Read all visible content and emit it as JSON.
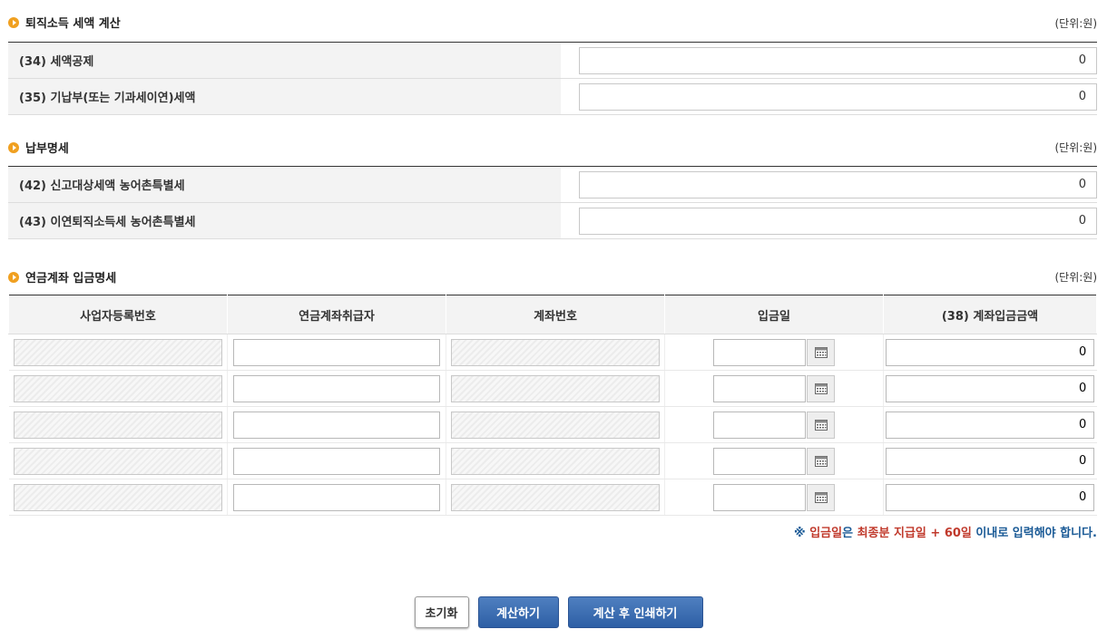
{
  "unit_label": "(단위:원)",
  "section1": {
    "title": "퇴직소득 세액 계산",
    "rows": [
      {
        "label": "(34) 세액공제",
        "value": "0"
      },
      {
        "label": "(35) 기납부(또는 기과세이연)세액",
        "value": "0"
      }
    ]
  },
  "section2": {
    "title": "납부명세",
    "rows": [
      {
        "label": "(42) 신고대상세액 농어촌특별세",
        "value": "0"
      },
      {
        "label": "(43) 이연퇴직소득세 농어촌특별세",
        "value": "0"
      }
    ]
  },
  "section3": {
    "title": "연금계좌 입금명세",
    "columns": [
      "사업자등록번호",
      "연금계좌취급자",
      "계좌번호",
      "입금일",
      "(38) 계좌입금금액"
    ],
    "rows": [
      {
        "amount": "0"
      },
      {
        "amount": "0"
      },
      {
        "amount": "0"
      },
      {
        "amount": "0"
      },
      {
        "amount": "0"
      }
    ]
  },
  "note": [
    {
      "text": "※ ",
      "color": "#1a5a96"
    },
    {
      "text": "입금일",
      "color": "#c0392b"
    },
    {
      "text": "은 ",
      "color": "#1a5a96"
    },
    {
      "text": "최종분 지급일 + 60일",
      "color": "#c0392b"
    },
    {
      "text": " 이내로 입력해야 합니다.",
      "color": "#1a5a96"
    }
  ],
  "buttons": {
    "reset": "초기화",
    "calculate": "계산하기",
    "calc_print": "계산 후 인쇄하기"
  },
  "icons": {
    "calendar": "calendar-icon",
    "bullet": "orange-circle-arrow-icon"
  }
}
